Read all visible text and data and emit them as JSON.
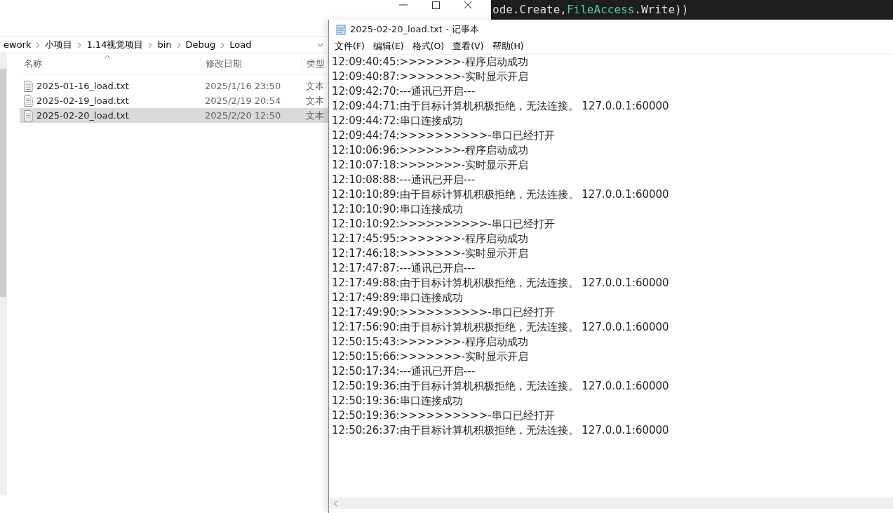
{
  "code_editor": {
    "tokens": [
      {
        "text": "ode.",
        "kind": "plain"
      },
      {
        "text": "Create",
        "kind": "plain"
      },
      {
        "text": ",",
        "kind": "plain"
      },
      {
        "text": "FileAccess",
        "kind": "type"
      },
      {
        "text": ".Write))",
        "kind": "plain"
      }
    ]
  },
  "explorer": {
    "breadcrumb": [
      "ework",
      "小项目",
      "1.14视觉项目",
      "bin",
      "Debug",
      "Load"
    ],
    "columns": [
      "名称",
      "修改日期",
      "类型"
    ],
    "files": [
      {
        "name": "2025-01-16_load.txt",
        "modified": "2025/1/16 23:50",
        "type": "文本",
        "selected": false
      },
      {
        "name": "2025-02-19_load.txt",
        "modified": "2025/2/19 20:54",
        "type": "文本",
        "selected": false
      },
      {
        "name": "2025-02-20_load.txt",
        "modified": "2025/2/20 12:50",
        "type": "文本",
        "selected": true
      }
    ]
  },
  "notepad": {
    "title": "2025-02-20_load.txt - 记事本",
    "menu": [
      "文件(F)",
      "编辑(E)",
      "格式(O)",
      "查看(V)",
      "帮助(H)"
    ],
    "lines": [
      "12:09:40:45:>>>>>>>-程序启动成功",
      "12:09:40:87:>>>>>>>-实时显示开启",
      "12:09:42:70:---通讯已开启---",
      "12:09:44:71:由于目标计算机积极拒绝，无法连接。 127.0.0.1:60000",
      "12:09:44:72:串口连接成功",
      "12:09:44:74:>>>>>>>>>>-串口已经打开",
      "12:10:06:96:>>>>>>>-程序启动成功",
      "12:10:07:18:>>>>>>>-实时显示开启",
      "12:10:08:88:---通讯已开启---",
      "12:10:10:89:由于目标计算机积极拒绝，无法连接。 127.0.0.1:60000",
      "12:10:10:90:串口连接成功",
      "12:10:10:92:>>>>>>>>>>-串口已经打开",
      "12:17:45:95:>>>>>>>-程序启动成功",
      "12:17:46:18:>>>>>>>-实时显示开启",
      "12:17:47:87:---通讯已开启---",
      "12:17:49:88:由于目标计算机积极拒绝，无法连接。 127.0.0.1:60000",
      "12:17:49:89:串口连接成功",
      "12:17:49:90:>>>>>>>>>>-串口已经打开",
      "12:17:56:90:由于目标计算机积极拒绝，无法连接。 127.0.0.1:60000",
      "12:50:15:43:>>>>>>>-程序启动成功",
      "12:50:15:66:>>>>>>>-实时显示开启",
      "12:50:17:34:---通讯已开启---",
      "12:50:19:36:由于目标计算机积极拒绝，无法连接。 127.0.0.1:60000",
      "12:50:19:36:串口连接成功",
      "12:50:19:36:>>>>>>>>>>-串口已经打开",
      "12:50:26:37:由于目标计算机积极拒绝，无法连接。 127.0.0.1:60000"
    ]
  }
}
